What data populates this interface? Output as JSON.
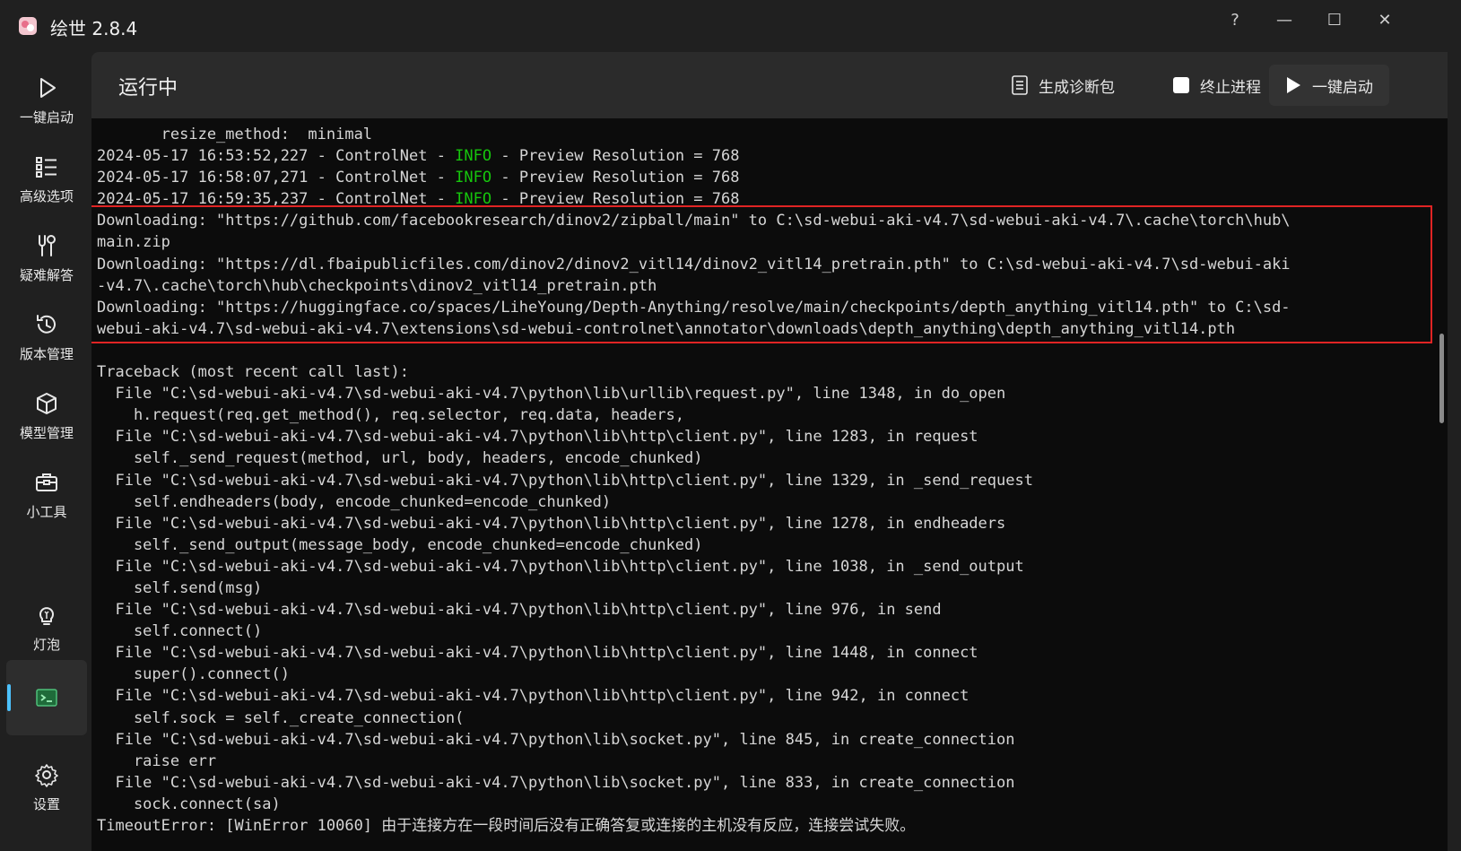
{
  "window": {
    "title": "绘世 2.8.4",
    "controls": {
      "help": "?",
      "minimize": "—",
      "maximize": "☐",
      "close": "✕"
    }
  },
  "sidebar": {
    "items": [
      {
        "label": "一键启动",
        "icon": "play-icon"
      },
      {
        "label": "高级选项",
        "icon": "list-icon"
      },
      {
        "label": "疑难解答",
        "icon": "wrench-icon"
      },
      {
        "label": "版本管理",
        "icon": "history-icon"
      },
      {
        "label": "模型管理",
        "icon": "cube-icon"
      },
      {
        "label": "小工具",
        "icon": "toolbox-icon"
      },
      {
        "label": "灯泡",
        "icon": "lightbulb-icon"
      },
      {
        "label": "",
        "icon": "console-icon"
      },
      {
        "label": "设置",
        "icon": "gear-icon"
      }
    ]
  },
  "header": {
    "status": "运行中",
    "diagnostics_label": "生成诊断包",
    "stop_label": "终止进程",
    "start_label": "一键启动"
  },
  "console": {
    "lines": [
      "       resize_method:  minimal",
      "2024-05-17 16:53:52,227 - ControlNet - |INFO| - Preview Resolution = 768",
      "2024-05-17 16:58:07,271 - ControlNet - |INFO| - Preview Resolution = 768",
      "2024-05-17 16:59:35,237 - ControlNet - |INFO| - Preview Resolution = 768",
      "Downloading: \"https://github.com/facebookresearch/dinov2/zipball/main\" to C:\\sd-webui-aki-v4.7\\sd-webui-aki-v4.7\\.cache\\torch\\hub\\",
      "main.zip",
      "Downloading: \"https://dl.fbaipublicfiles.com/dinov2/dinov2_vitl14/dinov2_vitl14_pretrain.pth\" to C:\\sd-webui-aki-v4.7\\sd-webui-aki",
      "-v4.7\\.cache\\torch\\hub\\checkpoints\\dinov2_vitl14_pretrain.pth",
      "Downloading: \"https://huggingface.co/spaces/LiheYoung/Depth-Anything/resolve/main/checkpoints/depth_anything_vitl14.pth\" to C:\\sd-",
      "webui-aki-v4.7\\sd-webui-aki-v4.7\\extensions\\sd-webui-controlnet\\annotator\\downloads\\depth_anything\\depth_anything_vitl14.pth",
      "",
      "Traceback (most recent call last):",
      "  File \"C:\\sd-webui-aki-v4.7\\sd-webui-aki-v4.7\\python\\lib\\urllib\\request.py\", line 1348, in do_open",
      "    h.request(req.get_method(), req.selector, req.data, headers,",
      "  File \"C:\\sd-webui-aki-v4.7\\sd-webui-aki-v4.7\\python\\lib\\http\\client.py\", line 1283, in request",
      "    self._send_request(method, url, body, headers, encode_chunked)",
      "  File \"C:\\sd-webui-aki-v4.7\\sd-webui-aki-v4.7\\python\\lib\\http\\client.py\", line 1329, in _send_request",
      "    self.endheaders(body, encode_chunked=encode_chunked)",
      "  File \"C:\\sd-webui-aki-v4.7\\sd-webui-aki-v4.7\\python\\lib\\http\\client.py\", line 1278, in endheaders",
      "    self._send_output(message_body, encode_chunked=encode_chunked)",
      "  File \"C:\\sd-webui-aki-v4.7\\sd-webui-aki-v4.7\\python\\lib\\http\\client.py\", line 1038, in _send_output",
      "    self.send(msg)",
      "  File \"C:\\sd-webui-aki-v4.7\\sd-webui-aki-v4.7\\python\\lib\\http\\client.py\", line 976, in send",
      "    self.connect()",
      "  File \"C:\\sd-webui-aki-v4.7\\sd-webui-aki-v4.7\\python\\lib\\http\\client.py\", line 1448, in connect",
      "    super().connect()",
      "  File \"C:\\sd-webui-aki-v4.7\\sd-webui-aki-v4.7\\python\\lib\\http\\client.py\", line 942, in connect",
      "    self.sock = self._create_connection(",
      "  File \"C:\\sd-webui-aki-v4.7\\sd-webui-aki-v4.7\\python\\lib\\socket.py\", line 845, in create_connection",
      "    raise err",
      "  File \"C:\\sd-webui-aki-v4.7\\sd-webui-aki-v4.7\\python\\lib\\socket.py\", line 833, in create_connection",
      "    sock.connect(sa)",
      "TimeoutError: [WinError 10060] 由于连接方在一段时间后没有正确答复或连接的主机没有反应，连接尝试失败。"
    ]
  },
  "colors": {
    "accent": "#4cc2ff",
    "info": "#16c60c",
    "highlight": "#e02424"
  }
}
